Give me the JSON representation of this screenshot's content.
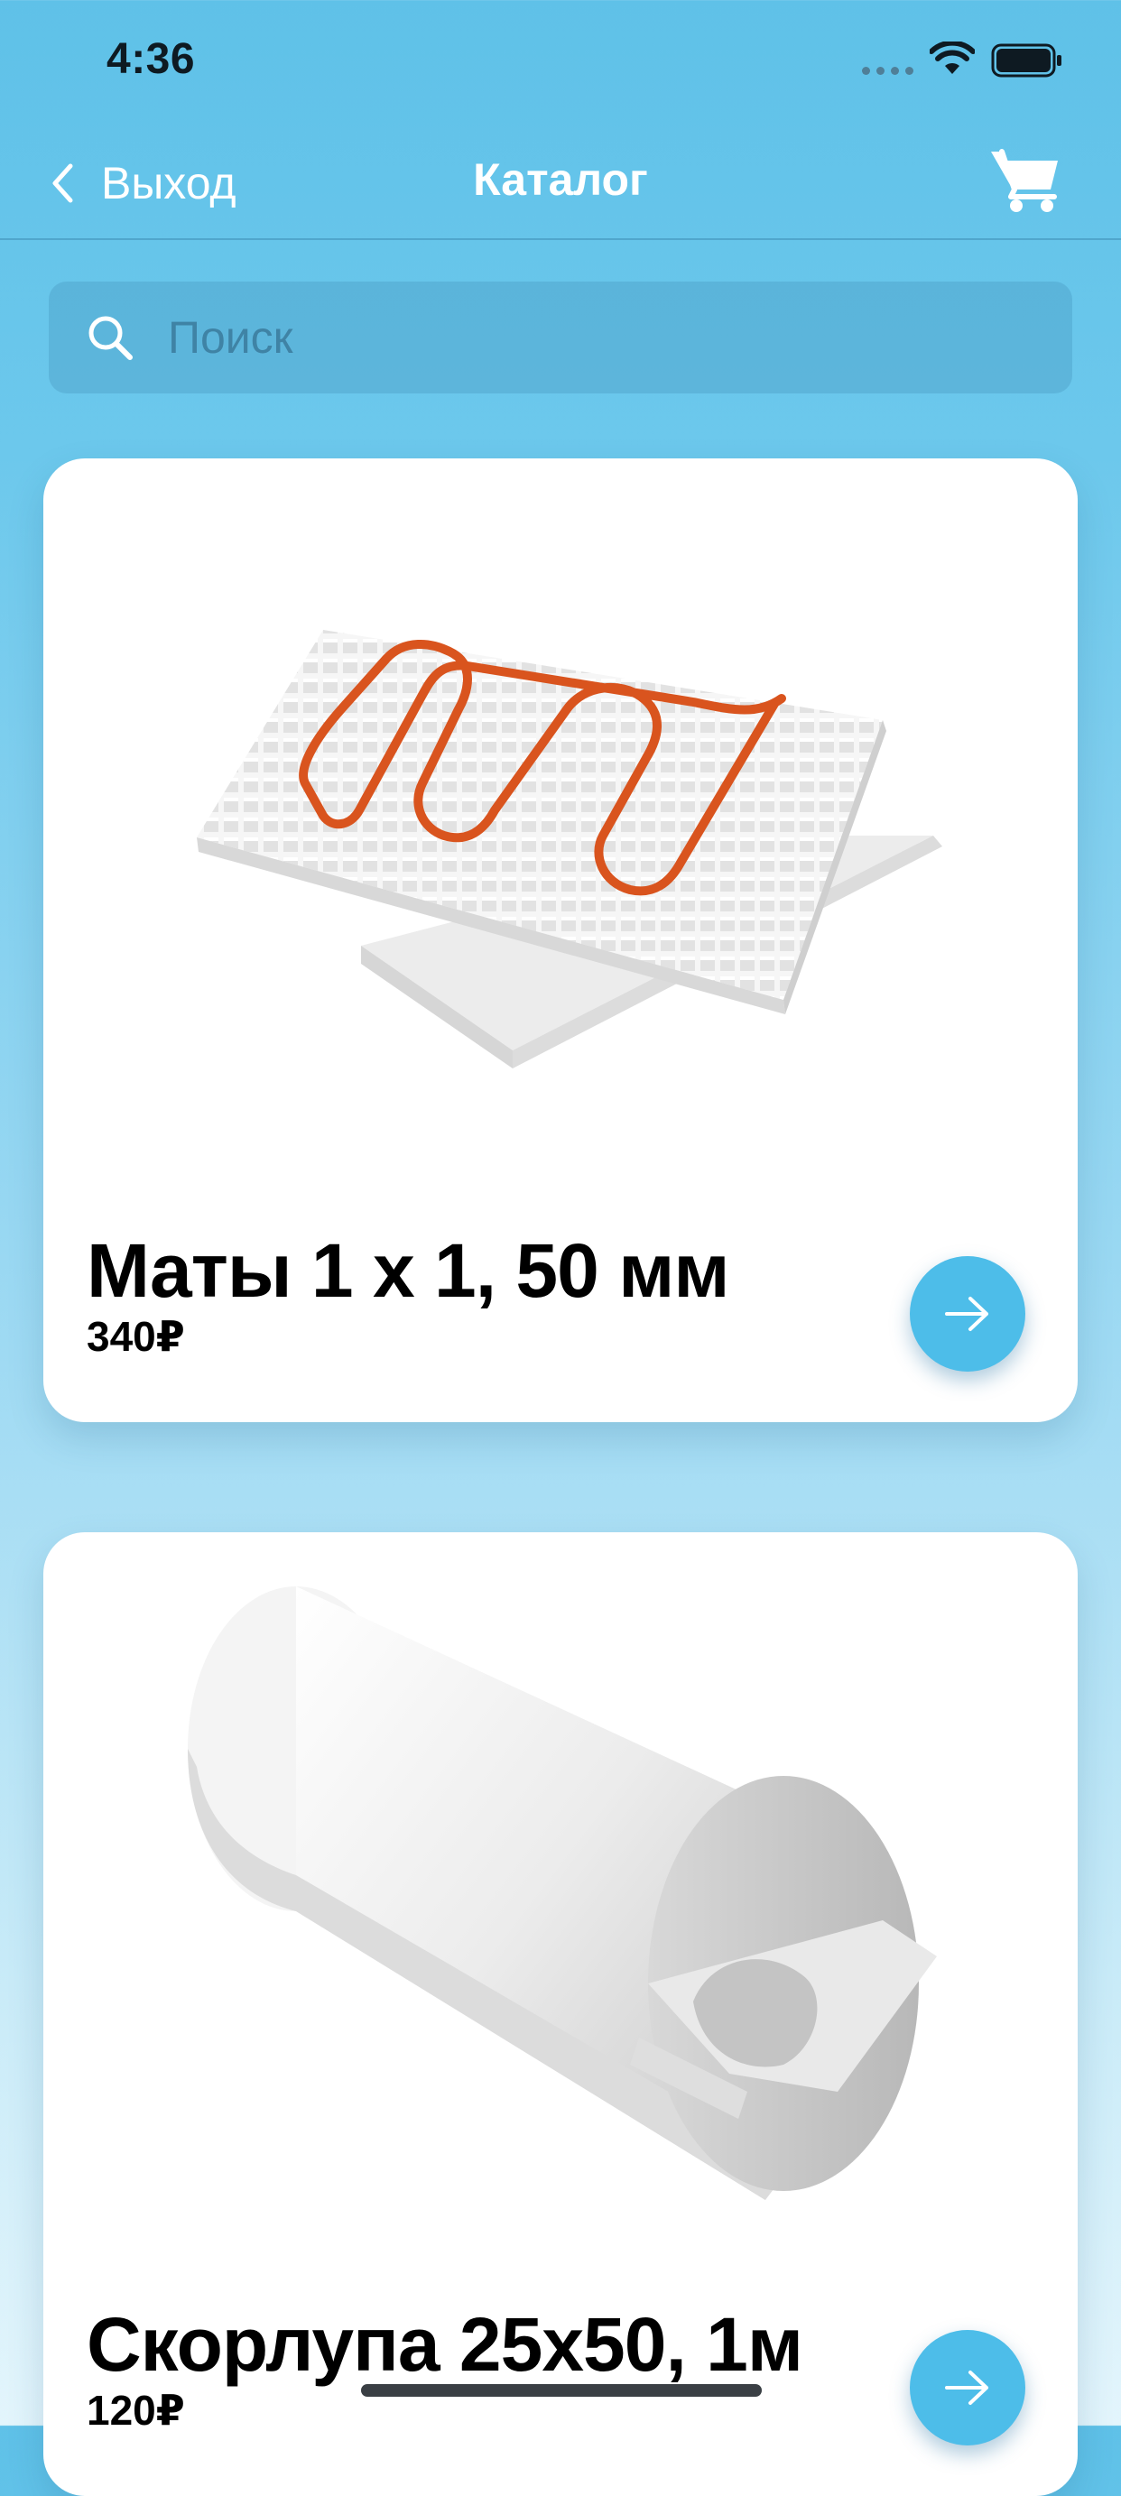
{
  "status_bar": {
    "time": "4:36"
  },
  "nav": {
    "back_label": "Выход",
    "title": "Каталог"
  },
  "search": {
    "placeholder": "Поиск",
    "value": ""
  },
  "products": [
    {
      "name": "Маты 1 x 1, 50 мм",
      "price": "340₽"
    },
    {
      "name": "Скорлупа 25x50, 1м",
      "price": "120₽"
    }
  ],
  "icons": {
    "back": "chevron-left-icon",
    "cart": "cart-icon",
    "search": "search-icon",
    "arrow": "arrow-right-icon"
  },
  "colors": {
    "accent": "#4dbde9",
    "background_top": "#5fc1e8",
    "card": "#ffffff",
    "pipe": "#d9541e"
  }
}
